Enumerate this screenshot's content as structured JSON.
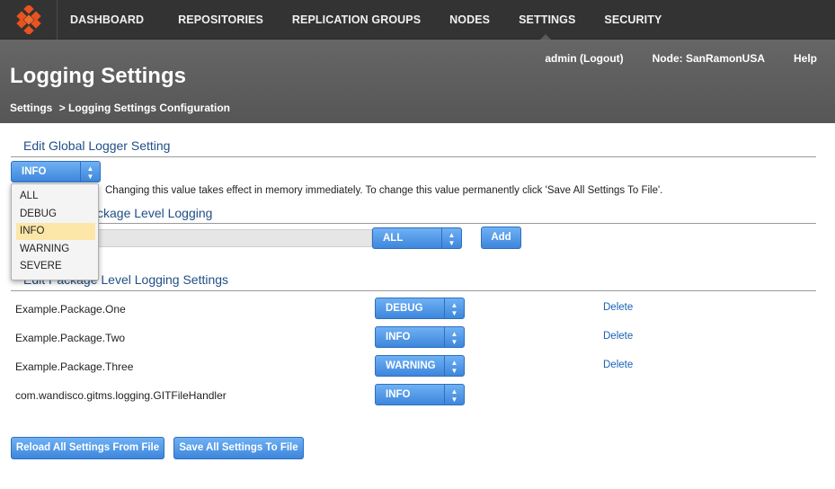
{
  "nav": {
    "items": [
      "DASHBOARD",
      "REPOSITORIES",
      "REPLICATION GROUPS",
      "NODES",
      "SETTINGS",
      "SECURITY"
    ],
    "active": "SETTINGS"
  },
  "header": {
    "title": "Logging Settings",
    "breadcrumb": [
      "Settings",
      "> Logging Settings Configuration"
    ],
    "user": "admin (Logout)",
    "node": "Node: SanRamonUSA",
    "help": "Help"
  },
  "global": {
    "title": "Edit Global Logger Setting",
    "selected": "INFO",
    "note": "Changing this value takes effect in memory immediately. To change this value permanently click 'Save All Settings To File'.",
    "options": [
      "ALL",
      "DEBUG",
      "INFO",
      "WARNING",
      "SEVERE"
    ]
  },
  "add_package": {
    "title_visible": "ckage Level Logging",
    "input_value": "",
    "level": "ALL",
    "add_label": "Add"
  },
  "edit_package": {
    "title_visible": "Edit Package Level Logging Settings",
    "rows": [
      {
        "name": "Example.Package.One",
        "level": "DEBUG",
        "delete": "Delete"
      },
      {
        "name": "Example.Package.Two",
        "level": "INFO",
        "delete": "Delete"
      },
      {
        "name": "Example.Package.Three",
        "level": "WARNING",
        "delete": "Delete"
      },
      {
        "name": "com.wandisco.gitms.logging.GITFileHandler",
        "level": "INFO",
        "delete": ""
      }
    ]
  },
  "footer": {
    "reload_label": "Reload All Settings From File",
    "save_label": "Save All Settings To File"
  },
  "colors": {
    "topbar": "#333333",
    "header": "#5e5e5e",
    "button": "#4a90e2",
    "section_title": "#1f4f86",
    "link": "#1a5fb4",
    "highlight": "#fde7a8"
  }
}
